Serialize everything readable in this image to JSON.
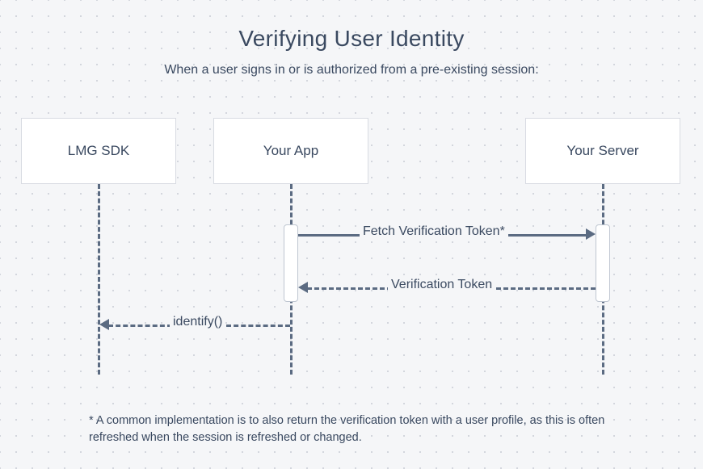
{
  "title": "Verifying User Identity",
  "subtitle": "When a user signs in or is authorized from a pre-existing session:",
  "participants": {
    "sdk": "LMG SDK",
    "app": "Your App",
    "server": "Your Server"
  },
  "messages": {
    "fetch": "Fetch Verification Token*",
    "token": "Verification Token",
    "identify": "identify()"
  },
  "footnote": "* A common implementation is to also return the verification token with a user profile, as this is often refreshed when the session is refreshed or changed."
}
